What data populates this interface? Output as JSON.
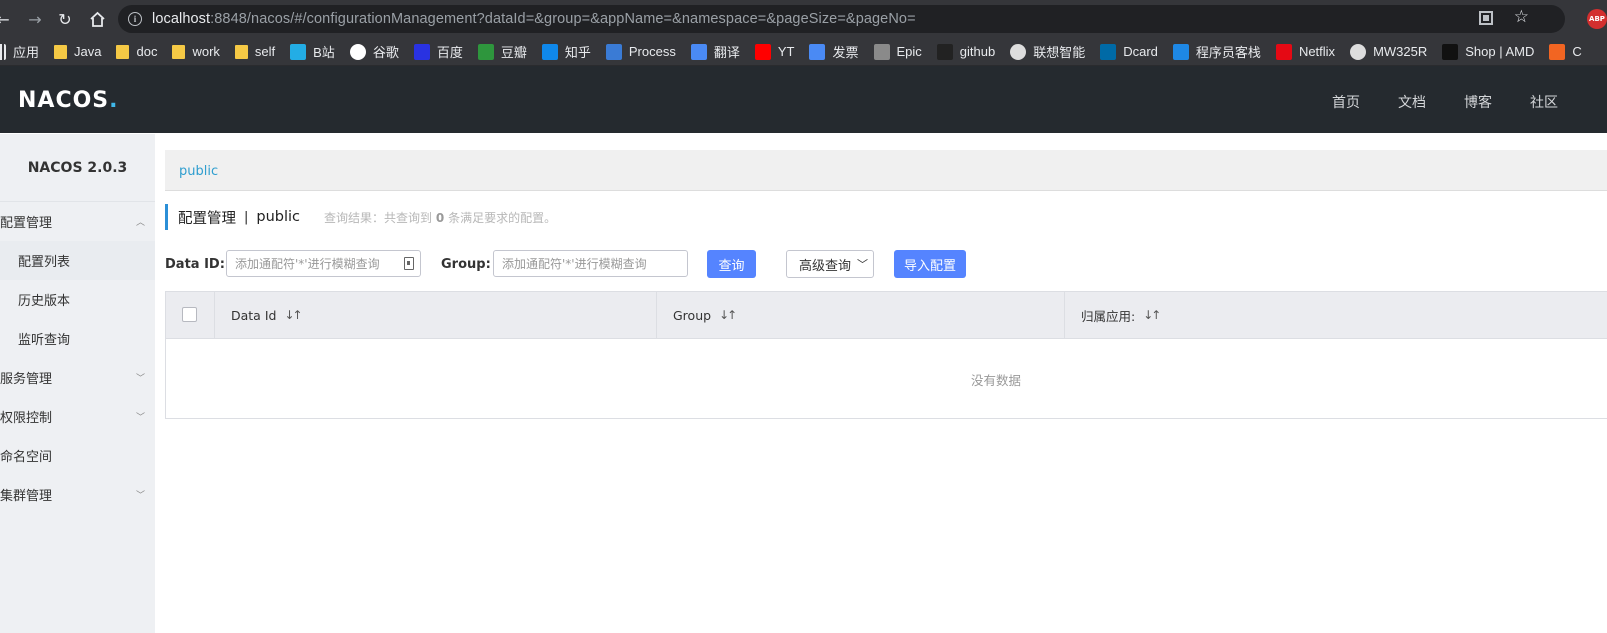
{
  "browser": {
    "url_host": "localhost",
    "url_rest": ":8848/nacos/#/configurationManagement?dataId=&group=&appName=&namespace=&pageSize=&pageNo=",
    "abp_label": "ABP",
    "bookmarks": [
      {
        "label": "应用",
        "icon": "apps-grid-icon",
        "color": "#f5c945"
      },
      {
        "label": "Java",
        "icon": "folder-icon",
        "color": "#f5c945"
      },
      {
        "label": "doc",
        "icon": "folder-icon",
        "color": "#f5c945"
      },
      {
        "label": "work",
        "icon": "folder-icon",
        "color": "#f5c945"
      },
      {
        "label": "self",
        "icon": "folder-icon",
        "color": "#f5c945"
      },
      {
        "label": "B站",
        "icon": "bilibili-icon",
        "color": "#23ade5"
      },
      {
        "label": "谷歌",
        "icon": "google-icon",
        "color": "#ffffff"
      },
      {
        "label": "百度",
        "icon": "baidu-icon",
        "color": "#2932e1"
      },
      {
        "label": "豆瓣",
        "icon": "douban-icon",
        "color": "#2e963d"
      },
      {
        "label": "知乎",
        "icon": "zhihu-icon",
        "color": "#0f88eb"
      },
      {
        "label": "Process",
        "icon": "processon-icon",
        "color": "#3a7bd5"
      },
      {
        "label": "翻译",
        "icon": "translate-icon",
        "color": "#4a8af4"
      },
      {
        "label": "YT",
        "icon": "youtube-icon",
        "color": "#ff0000"
      },
      {
        "label": "发票",
        "icon": "search-globe-icon",
        "color": "#4a8af4"
      },
      {
        "label": "Epic",
        "icon": "epic-icon",
        "color": "#8a8a8a"
      },
      {
        "label": "github",
        "icon": "github-icon",
        "color": "#222222"
      },
      {
        "label": "联想智能",
        "icon": "globe-icon",
        "color": "#dddddd"
      },
      {
        "label": "Dcard",
        "icon": "dcard-icon",
        "color": "#006aa6"
      },
      {
        "label": "程序员客栈",
        "icon": "terminal-icon",
        "color": "#1e88e5"
      },
      {
        "label": "Netflix",
        "icon": "netflix-icon",
        "color": "#e50914"
      },
      {
        "label": "MW325R",
        "icon": "globe-icon",
        "color": "#dddddd"
      },
      {
        "label": "Shop | AMD",
        "icon": "amd-icon",
        "color": "#111111"
      },
      {
        "label": "C",
        "icon": "c-icon",
        "color": "#f26522"
      }
    ]
  },
  "header": {
    "logo_text": "NACOS",
    "logo_dot": ".",
    "nav": [
      "首页",
      "文档",
      "博客",
      "社区"
    ]
  },
  "sidebar": {
    "version": "NACOS 2.0.3",
    "menu": {
      "config_mgmt": "配置管理",
      "config_list": "配置列表",
      "history": "历史版本",
      "listener_query": "监听查询",
      "service_mgmt": "服务管理",
      "access_control": "权限控制",
      "namespace": "命名空间",
      "cluster_mgmt": "集群管理"
    }
  },
  "namespace_bar": {
    "current": "public"
  },
  "page": {
    "title": "配置管理",
    "separator": "|",
    "namespace": "public",
    "query_result_prefix": "查询结果：共查询到",
    "query_result_count": "0",
    "query_result_suffix": "条满足要求的配置。"
  },
  "filters": {
    "data_id_label": "Data ID:",
    "data_id_placeholder": "添加通配符'*'进行模糊查询",
    "group_label": "Group:",
    "group_placeholder": "添加通配符'*'进行模糊查询",
    "search_button": "查询",
    "advanced_button": "高级查询",
    "import_button": "导入配置"
  },
  "table": {
    "columns": [
      "Data Id",
      "Group",
      "归属应用:"
    ],
    "sort_icon": "↓↑",
    "empty_text": "没有数据"
  },
  "colors": {
    "primary": "#5584ff",
    "link": "#2f9ecf",
    "header_bg": "#252a2f",
    "sidebar_bg": "#eef0f3"
  }
}
